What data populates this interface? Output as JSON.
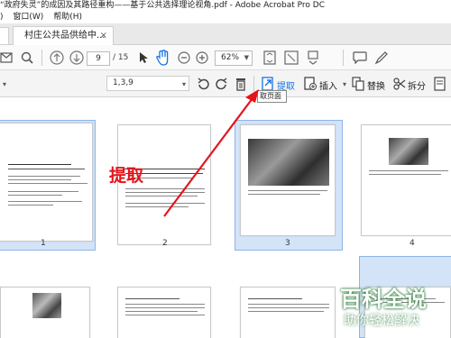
{
  "window": {
    "title": "“政府失灵”的成因及其路径重构——基于公共选择理论视角.pdf - Adobe Acrobat Pro DC"
  },
  "menu": {
    "items": [
      "窗口(W)",
      "帮助(H)"
    ],
    "lead": ")"
  },
  "tab": {
    "label": "村庄公共品供给中...",
    "close": "×"
  },
  "toolbar": {
    "page_current": "9",
    "page_total": "/ 15",
    "zoom": "62%"
  },
  "organize": {
    "range": "1,3,9",
    "extract": "提取",
    "insert": "插入",
    "replace": "替换",
    "split": "拆分"
  },
  "tooltip": "取页面",
  "annotation": "提取",
  "thumbnails": [
    {
      "num": "1",
      "selected": true
    },
    {
      "num": "2",
      "selected": false
    },
    {
      "num": "3",
      "selected": true
    },
    {
      "num": "4",
      "selected": false
    }
  ],
  "watermark": {
    "line1": "百科全说",
    "line2": "助你轻松解决"
  },
  "colors": {
    "accent": "#1473e6",
    "selection": "#d3e3f8",
    "annotation": "#e4141b"
  }
}
